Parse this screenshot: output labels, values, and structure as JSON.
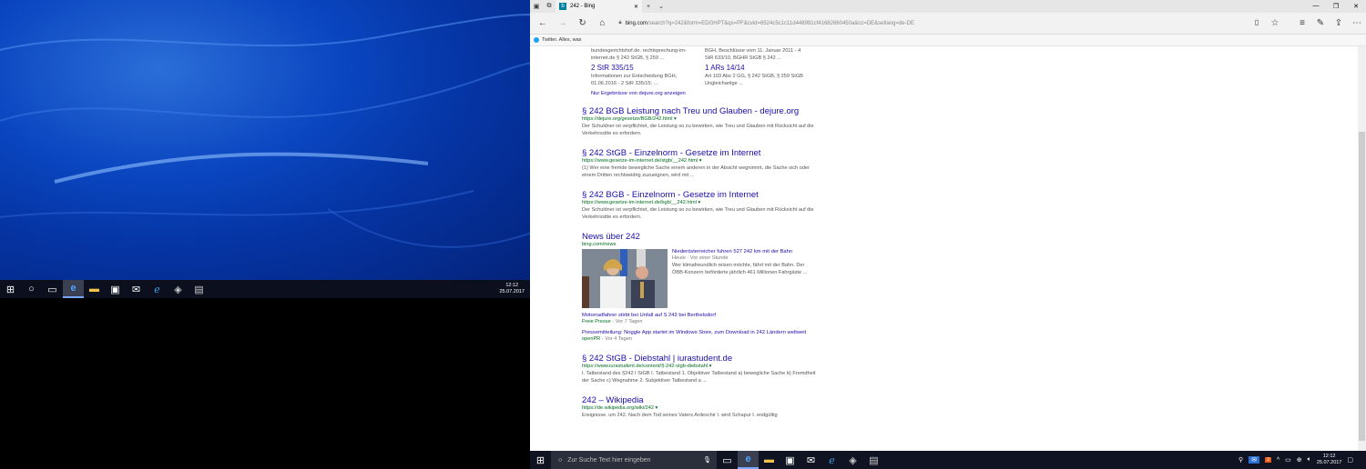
{
  "left_taskbar": {
    "time": "12:12",
    "date": "25.07.2017",
    "icons": [
      "windows-start-icon",
      "cortana-circle-icon",
      "task-view-icon",
      "edge-icon",
      "file-explorer-icon",
      "store-icon",
      "mail-icon",
      "ie-icon",
      "app-icon",
      "notepad-icon"
    ]
  },
  "browser": {
    "tab_title": "242 - Bing",
    "url_domain": "bing.com",
    "url_rest": "/search?q=242&form=EDGHPT&qs=PF&cvid=6524c5c1c11d448991cf41682660450a&cc=DE&setlang=de-DE",
    "favorite": "Twitter. Alles, was",
    "dejure_top_left": "bundesgerichtshof.de. rechtsprechung-im-internet.de § 242 StGB, § 259 ...",
    "dejure_top_right": "BGH, Beschlüsse vom 11. Januar 2011 - 4 StR 633/10, BGHR StGB § 242 ...",
    "dejure_cards": [
      {
        "title": "2 StR 335/15",
        "text": "Informationen zur Entscheidung BGH, 01.06.2016 - 2 StR 335/15: ..."
      },
      {
        "title": "1 ARs 14/14",
        "text": "Art 103 Abs 2 GG, § 242 StGB, § 259 StGB Ungleichartige ..."
      }
    ],
    "dejure_more": "Nur Ergebnisse von dejure.org anzeigen",
    "results": [
      {
        "title": "§ 242 BGB Leistung nach Treu und Glauben - dejure.org",
        "url": "https://dejure.org/gesetze/BGB/242.html",
        "snippet": "Der Schuldner ist verpflichtet, die Leistung so zu bewirken, wie Treu und Glauben mit Rücksicht auf die Verkehrssitte es erfordern."
      },
      {
        "title": "§ 242 StGB - Einzelnorm - Gesetze im Internet",
        "url": "https://www.gesetze-im-internet.de/stgb/__242.html",
        "snippet": "(1) Wer eine fremde bewegliche Sache einem anderen in der Absicht wegnimmt, die Sache sich oder einem Dritten rechtswidrig zuzueignen, wird mit ..."
      },
      {
        "title": "§ 242 BGB - Einzelnorm - Gesetze im Internet",
        "url": "https://www.gesetze-im-internet.de/bgb/__242.html",
        "snippet": "Der Schuldner ist verpflichtet, die Leistung so zu bewirken, wie Treu und Glauben mit Rücksicht auf die Verkehrssitte es erfordern."
      }
    ],
    "news": {
      "title": "News über 242",
      "source_url": "bing.com/news",
      "main_link": "Niederösterreicher fuhren 527 242 km mit der Bahn",
      "main_meta": "Heute · Vor einer Stunde",
      "main_snippet": "Wer klimafreundlich reisen möchte, fährt mit der Bahn. Der ÖBB-Konzern beförderte jährlich 461 Millionen Fahrgäste ...",
      "items": [
        {
          "link": "Motorradfahrer stirbt bei Unfall auf S 242 bei Berthelsdorf",
          "source": "Freie Presse",
          "age": "Vor 7 Tagen"
        },
        {
          "link": "Pressemitteilung: Noggle App startet im Windows Store, zum Download in 242 Ländern weltweit",
          "source": "openPR",
          "age": "Vor 4 Tagen"
        }
      ]
    },
    "results2": [
      {
        "title": "§ 242 StGB - Diebstahl | iurastudent.de",
        "url": "https://www.iurastudent.de/content/§-242-stgb-diebstahl",
        "snippet": "I. Tatbestand des §242 I StGB I. Tatbestand 1. Objektiver Tatbestand a) bewegliche Sache b) Fremdheit der Sache c) Wegnahme 2. Subjektiver Tatbestand a ..."
      },
      {
        "title": "242 – Wikipedia",
        "url": "https://de.wikipedia.org/wiki/242",
        "snippet": "Ereignisse. um 242. Nach dem Tod seines Vaters Ardeschir I. wird Schapur I. endgültig"
      }
    ]
  },
  "right_taskbar": {
    "search_placeholder": "Zur Suche Text hier eingeben",
    "time": "12:12",
    "date": "25.07.2017",
    "mail_badge": "3"
  }
}
